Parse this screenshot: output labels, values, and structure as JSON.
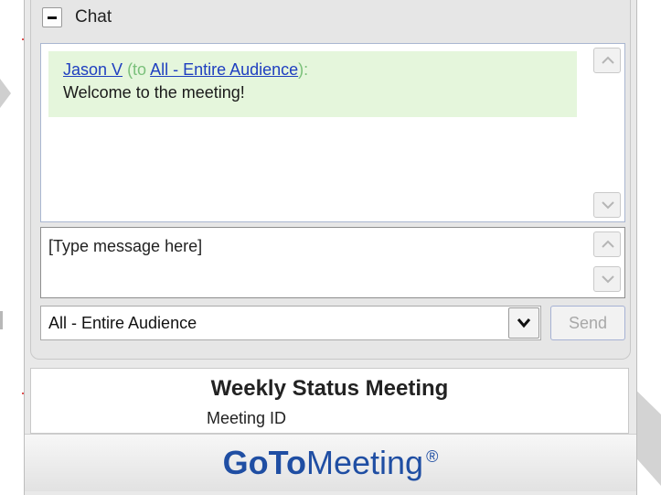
{
  "chat": {
    "title": "Chat",
    "messages": [
      {
        "sender": "Jason V",
        "to_prefix": "(to ",
        "recipient": "All - Entire Audience",
        "to_suffix": "):",
        "text": "Welcome to the meeting!"
      }
    ],
    "compose_placeholder": "[Type message here]",
    "recipient_value": "All - Entire Audience",
    "send_label": "Send"
  },
  "meeting": {
    "title": "Weekly Status Meeting",
    "id_label": "Meeting ID"
  },
  "brand": {
    "part1": "GoTo",
    "part2": "Meeting",
    "reg": "®",
    "color": "#1f4ea3"
  },
  "icons": [
    "collapse-icon",
    "scroll-up-icon",
    "scroll-down-icon",
    "dropdown-arrow-icon"
  ]
}
